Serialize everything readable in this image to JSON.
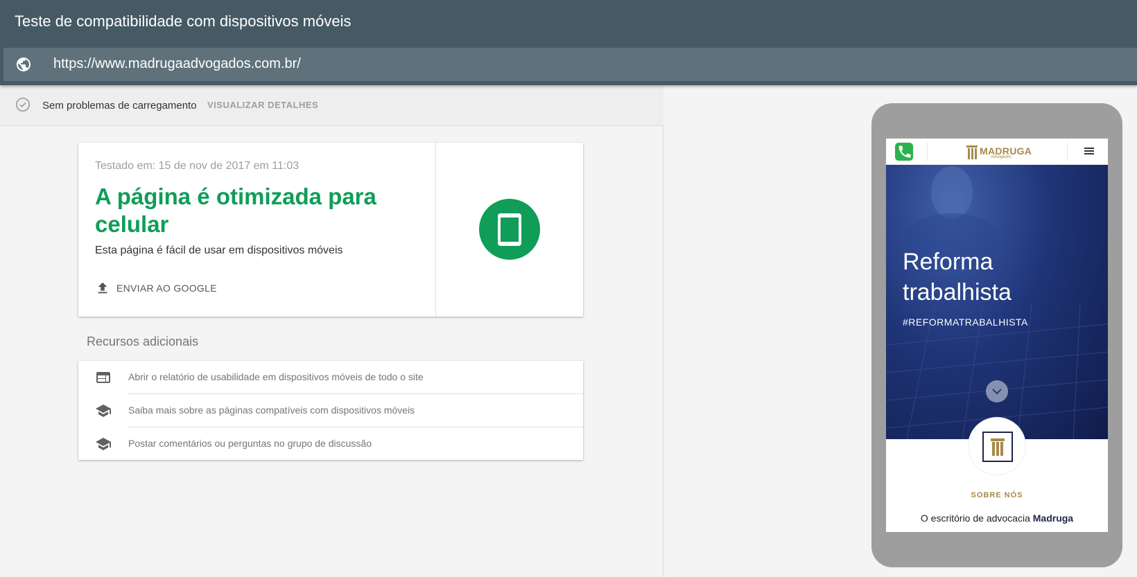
{
  "header": {
    "title": "Teste de compatibilidade com dispositivos móveis",
    "url": "https://www.madrugaadvogados.com.br/"
  },
  "status": {
    "text": "Sem problemas de carregamento",
    "details_link": "VISUALIZAR DETALHES"
  },
  "result": {
    "tested_on": "Testado em: 15 de nov de 2017 em 11:03",
    "title": "A página é otimizada para celular",
    "description": "Esta página é fácil de usar em dispositivos móveis",
    "send_button": "ENVIAR AO GOOGLE",
    "accent_color": "#0f9d58"
  },
  "resources": {
    "heading": "Recursos adicionais",
    "items": [
      {
        "label": "Abrir o relatório de usabilidade em dispositivos móveis de todo o site",
        "icon": "web-icon"
      },
      {
        "label": "Saiba mais sobre as páginas compatíveis com dispositivos móveis",
        "icon": "school-icon"
      },
      {
        "label": "Postar comentários ou perguntas no grupo de discussão",
        "icon": "school-icon"
      }
    ]
  },
  "preview": {
    "logo_text": "MADRUGA",
    "logo_sub": "Advogados",
    "hero_title_line1": "Reforma",
    "hero_title_line2": "trabalhista",
    "hero_tag": "#REFORMATRABALHISTA",
    "about_label": "SOBRE NÓS",
    "about_text_prefix": "O escritório de advocacia ",
    "about_text_bold": "Madruga"
  }
}
